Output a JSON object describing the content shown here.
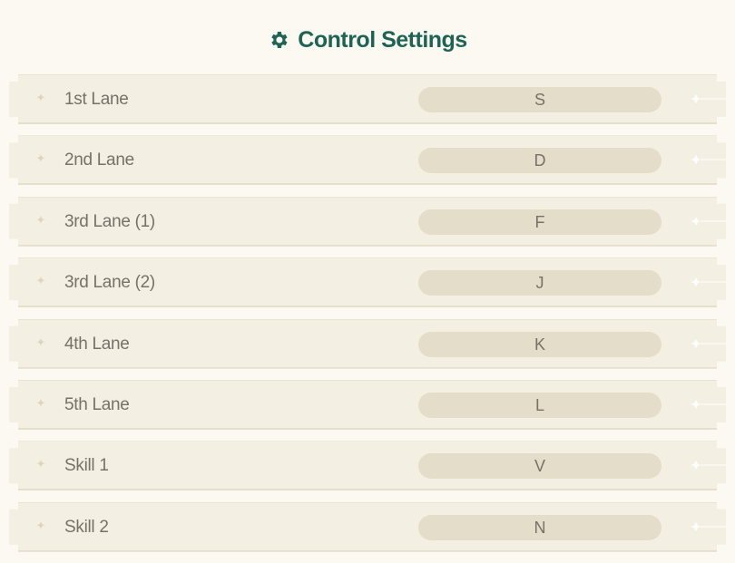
{
  "title": "Control Settings",
  "colors": {
    "accent": "#1e6353",
    "background": "#fbf9f2",
    "row": "#f3efe2",
    "key_pill": "#e4ddc9",
    "text": "#777168"
  },
  "icons": {
    "title_icon": "gear-icon",
    "row_left": "sparkle-icon",
    "row_right": "sparkle-line-icon"
  },
  "controls": [
    {
      "label": "1st Lane",
      "key": "S"
    },
    {
      "label": "2nd Lane",
      "key": "D"
    },
    {
      "label": "3rd Lane (1)",
      "key": "F"
    },
    {
      "label": "3rd Lane (2)",
      "key": "J"
    },
    {
      "label": "4th Lane",
      "key": "K"
    },
    {
      "label": "5th Lane",
      "key": "L"
    },
    {
      "label": "Skill 1",
      "key": "V"
    },
    {
      "label": "Skill 2",
      "key": "N"
    }
  ]
}
